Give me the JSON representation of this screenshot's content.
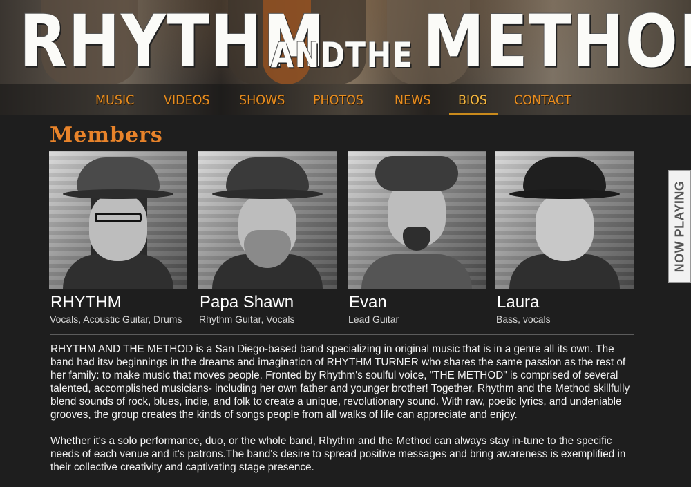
{
  "header": {
    "logo_words": [
      "RHYTHM",
      "AND",
      "THE",
      "METHOD"
    ]
  },
  "nav": {
    "items": [
      {
        "label": "MUSIC"
      },
      {
        "label": "VIDEOS"
      },
      {
        "label": "SHOWS"
      },
      {
        "label": "PHOTOS"
      },
      {
        "label": "NEWS"
      },
      {
        "label": "BIOS",
        "active": true
      },
      {
        "label": "CONTACT"
      }
    ],
    "colors": {
      "text": "#e88d1f",
      "active": "#f5b840"
    }
  },
  "members_section": {
    "title": "Members",
    "members": [
      {
        "name": "RHYTHM",
        "role": "Vocals, Acoustic Guitar, Drums"
      },
      {
        "name": "Papa Shawn",
        "role": "Rhythm Guitar, Vocals"
      },
      {
        "name": "Evan",
        "role": "Lead Guitar"
      },
      {
        "name": "Laura",
        "role": "Bass, vocals"
      }
    ]
  },
  "bio": {
    "paragraphs": [
      "RHYTHM AND THE METHOD is a San Diego-based band specializing in original music that is in a genre all its own. The band had itsv beginnings in the dreams and imagination of RHYTHM TURNER who shares the same passion as the rest of her family: to make music that moves people. Fronted by Rhythm's soulful voice, \"THE METHOD\" is comprised of several talented, accomplished musicians- including her own father and younger brother! Together, Rhythm and the Method skillfully blend sounds of rock, blues, indie, and folk to create a unique, revolutionary sound. With raw, poetic lyrics, and undeniable grooves, the group creates the kinds of songs people from all walks of life can appreciate and enjoy.",
      "Whether it's a solo performance, duo, or the whole band, Rhythm and the Method can always stay in-tune to the specific needs of each venue and it's patrons.The band's desire to spread positive messages and bring awareness is exemplified in their collective creativity and captivating stage presence."
    ]
  },
  "now_playing": {
    "label": "NOW PLAYING"
  },
  "colors": {
    "accent": "#e8832a",
    "background": "#1e1e1e"
  }
}
